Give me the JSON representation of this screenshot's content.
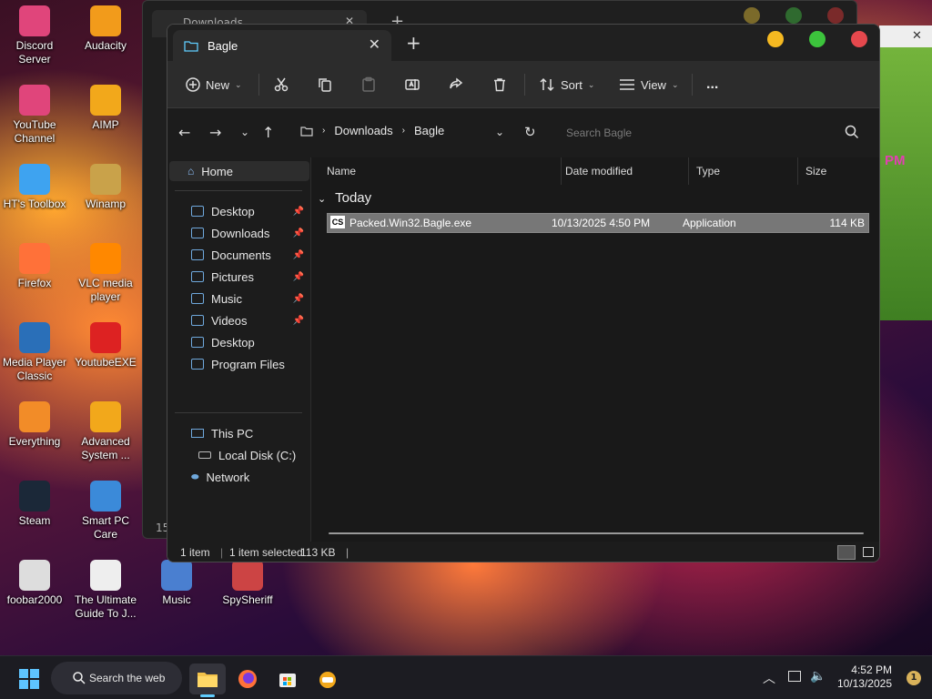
{
  "desktop": {
    "icons": [
      {
        "label": "Discord Server",
        "icon": "discord-icon",
        "color": "#e0457b"
      },
      {
        "label": "Audacity",
        "icon": "audacity-icon",
        "color": "#f29b1b"
      },
      {
        "label": "YouTube Channel",
        "icon": "youtube-icon",
        "color": "#e0457b"
      },
      {
        "label": "AIMP",
        "icon": "aimp-icon",
        "color": "#f2a81b"
      },
      {
        "label": "HT's Toolbox",
        "icon": "folder-icon",
        "color": "#3ea3f0"
      },
      {
        "label": "Winamp",
        "icon": "winamp-icon",
        "color": "#c9a24a"
      },
      {
        "label": "Firefox",
        "icon": "firefox-icon",
        "color": "#ff7139"
      },
      {
        "label": "VLC media player",
        "icon": "vlc-icon",
        "color": "#ff8800"
      },
      {
        "label": "Media Player Classic",
        "icon": "mpc-icon",
        "color": "#2a6fb8"
      },
      {
        "label": "YoutubeEXE",
        "icon": "youtube-exe-icon",
        "color": "#d22"
      },
      {
        "label": "Everything",
        "icon": "everything-icon",
        "color": "#f28c28"
      },
      {
        "label": "Advanced System ...",
        "icon": "advanced-systemcare-icon",
        "color": "#f2a81b"
      },
      {
        "label": "Steam",
        "icon": "steam-icon",
        "color": "#1b2838"
      },
      {
        "label": "Smart PC Care",
        "icon": "smart-pc-care-icon",
        "color": "#3b8ad9"
      },
      {
        "label": "foobar2000",
        "icon": "foobar-icon",
        "color": "#ddd"
      },
      {
        "label": "The Ultimate Guide To J...",
        "icon": "document-icon",
        "color": "#eee"
      },
      {
        "label": "Music",
        "icon": "music-folder-icon",
        "color": "#4a7fd0"
      },
      {
        "label": "SpySheriff",
        "icon": "spysheriff-icon",
        "color": "#c44"
      }
    ]
  },
  "background_window": {
    "tab_title": "Downloads",
    "side_text": "15"
  },
  "green_window": {
    "text": "PM"
  },
  "explorer": {
    "tab_title": "Bagle",
    "toolbar": {
      "new": "New",
      "sort": "Sort",
      "view": "View",
      "more": "..."
    },
    "breadcrumb": [
      "Downloads",
      "Bagle"
    ],
    "search_placeholder": "Search Bagle",
    "sidebar": {
      "home": "Home",
      "quick": [
        {
          "label": "Desktop",
          "pinned": true
        },
        {
          "label": "Downloads",
          "pinned": true
        },
        {
          "label": "Documents",
          "pinned": true
        },
        {
          "label": "Pictures",
          "pinned": true
        },
        {
          "label": "Music",
          "pinned": true
        },
        {
          "label": "Videos",
          "pinned": true
        },
        {
          "label": "Desktop",
          "pinned": false
        },
        {
          "label": "Program Files",
          "pinned": false
        }
      ],
      "this_pc": "This PC",
      "local_disk": "Local Disk (C:)",
      "network": "Network"
    },
    "columns": {
      "name": "Name",
      "date": "Date modified",
      "type": "Type",
      "size": "Size"
    },
    "group_label": "Today",
    "files": [
      {
        "name": "Packed.Win32.Bagle.exe",
        "date": "10/13/2025 4:50 PM",
        "type": "Application",
        "size": "114 KB",
        "icon_text": "CS"
      }
    ],
    "status": {
      "count": "1 item",
      "selected": "1 item selected",
      "size": "113 KB"
    }
  },
  "taskbar": {
    "search_label": "Search the web",
    "time": "4:52 PM",
    "date": "10/13/2025",
    "notification_count": "1"
  },
  "colors": {
    "accent": "#60cdff",
    "selected_row": "#777777",
    "close": "#e5484d",
    "minimize": "#f5b921",
    "maximize": "#3cc43c"
  }
}
